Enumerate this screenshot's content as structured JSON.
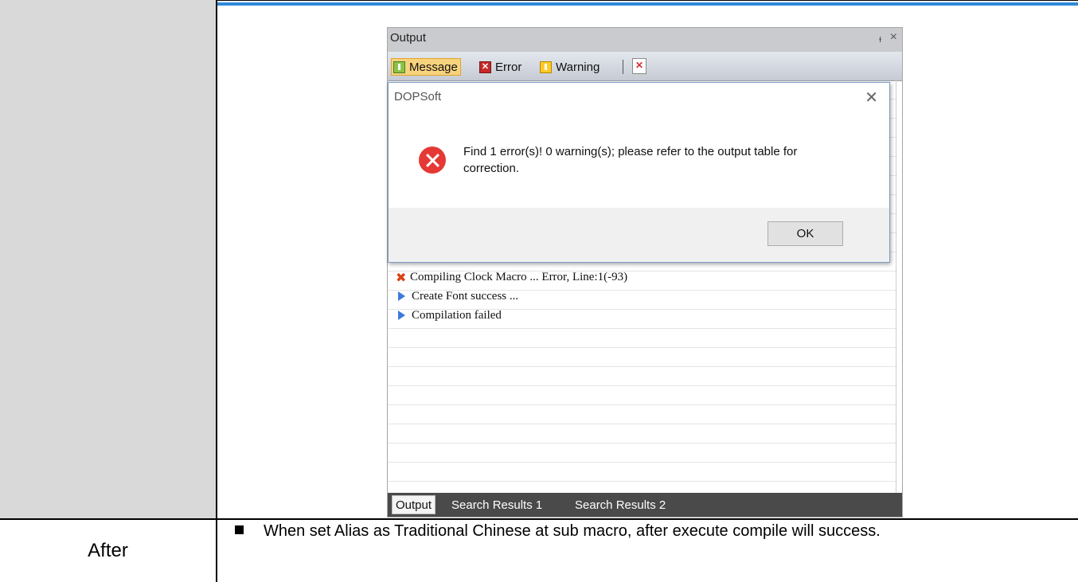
{
  "panel": {
    "title": "Output",
    "pin_glyph": "ᵻ",
    "close_glyph": "×",
    "toolbar": {
      "message_label": "Message",
      "error_label": "Error",
      "warning_label": "Warning"
    },
    "log_lines": [
      {
        "icon": "error-x-icon",
        "text": "Compiling Clock Macro ... Error, Line:1(-93)"
      },
      {
        "icon": "info-arrow-icon",
        "text": "Create Font success ..."
      },
      {
        "icon": "info-arrow-icon",
        "text": "Compilation failed"
      }
    ],
    "tabs": [
      "Output",
      "Search Results 1",
      "Search Results 2"
    ],
    "active_tab": "Output"
  },
  "dialog": {
    "title": "DOPSoft",
    "message": "Find 1 error(s)! 0 warning(s); please refer to the output table for correction.",
    "ok_label": "OK",
    "icon": "error-circle-icon"
  },
  "document": {
    "row_label": "After",
    "bullet_text": "When set Alias as Traditional Chinese at sub macro, after execute compile will success."
  },
  "colors": {
    "accent_line": "#2e8ad8",
    "left_cell_bg": "#d9d9d9",
    "active_toolbar_btn": "#f8d37d",
    "error_red": "#e53935"
  }
}
